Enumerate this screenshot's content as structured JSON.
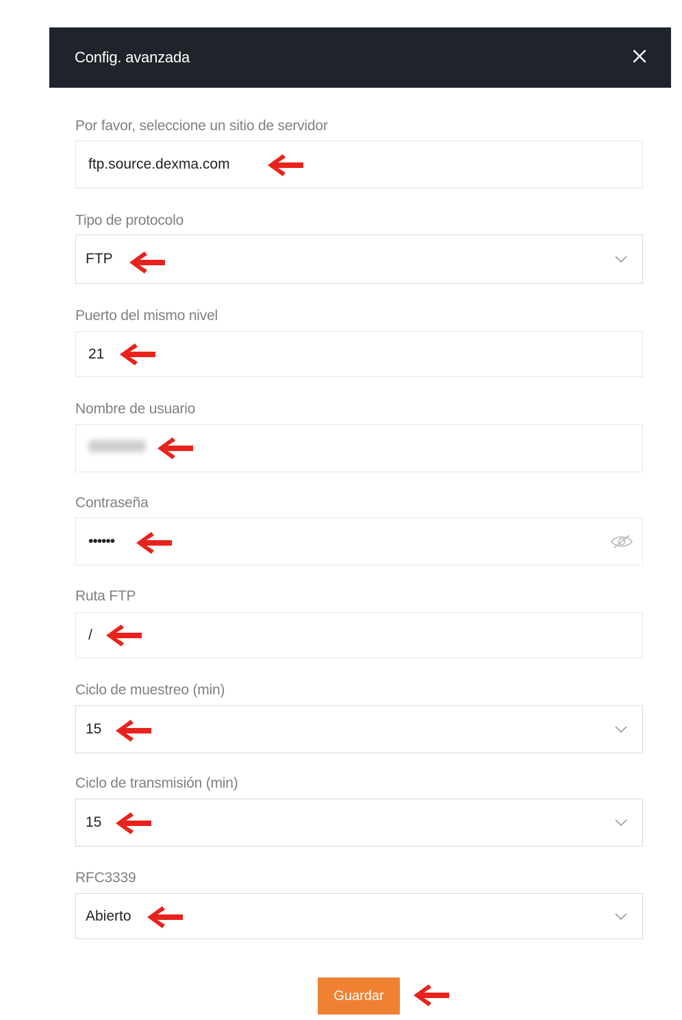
{
  "dialog": {
    "title": "Config. avanzada"
  },
  "fields": {
    "server": {
      "label": "Por favor, seleccione un sitio de servidor",
      "value": "ftp.source.dexma.com"
    },
    "protocol": {
      "label": "Tipo de protocolo",
      "value": "FTP"
    },
    "port": {
      "label": "Puerto del mismo nivel",
      "value": "21"
    },
    "username": {
      "label": "Nombre de usuario",
      "value": ""
    },
    "password": {
      "label": "Contraseña",
      "value": "••••••"
    },
    "ftp_path": {
      "label": "Ruta FTP",
      "value": "/"
    },
    "sampling_cycle": {
      "label": "Ciclo de muestreo (min)",
      "value": "15"
    },
    "transmission_cycle": {
      "label": "Ciclo de transmisión (min)",
      "value": "15"
    },
    "rfc3339": {
      "label": "RFC3339",
      "value": "Abierto"
    }
  },
  "actions": {
    "save_label": "Guardar"
  },
  "colors": {
    "header_bg": "#1f242b",
    "button_bg": "#f08132",
    "annotation_arrow": "#e8231c"
  },
  "icons": [
    "close-icon",
    "chevron-down-icon",
    "eye-slash-icon",
    "arrow-left-icon"
  ]
}
